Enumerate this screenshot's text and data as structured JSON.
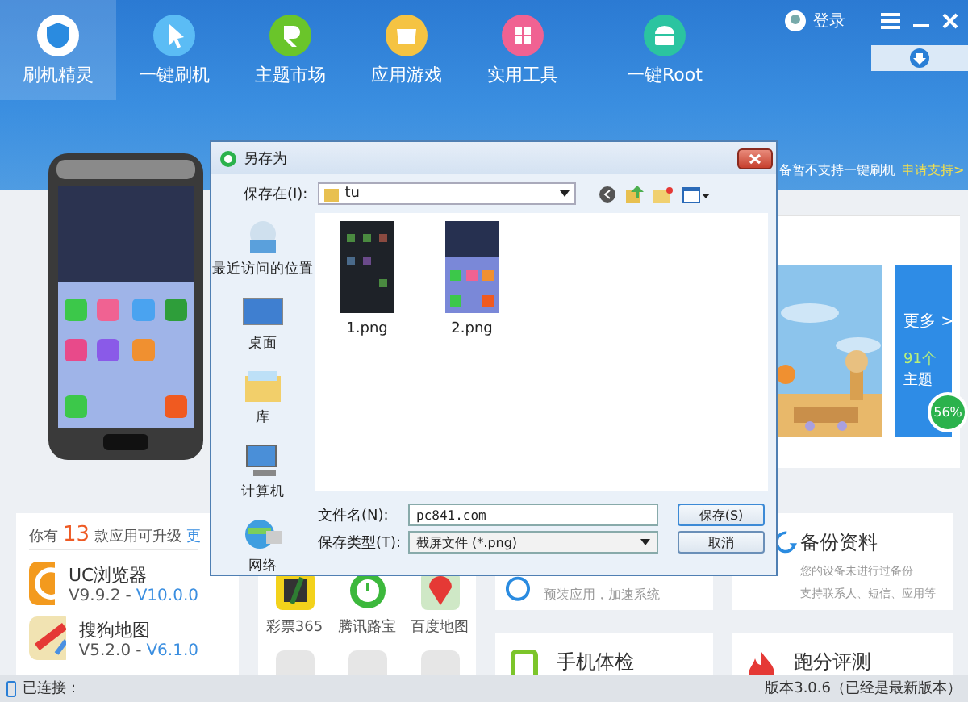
{
  "header": {
    "nav_items": [
      {
        "label": "刷机精灵",
        "kind": "shield",
        "selected": true
      },
      {
        "label": "一键刷机",
        "kind": "cursor",
        "selected": false
      },
      {
        "label": "主题市场",
        "kind": "ring",
        "selected": false
      },
      {
        "label": "应用游戏",
        "kind": "bag",
        "selected": false
      },
      {
        "label": "实用工具",
        "kind": "grid",
        "selected": false
      },
      {
        "label": "一键Root",
        "kind": "android",
        "selected": false
      }
    ],
    "login": "登录",
    "notice": "备暂不支持一键刷机",
    "notice_link": "申请支持>"
  },
  "themes": {
    "more": "更多 >",
    "count": "91个",
    "count_label": "主题",
    "progress": "56%"
  },
  "updates": {
    "prefix": "你有",
    "count": "13",
    "suffix": "款应用可升级",
    "more": "更",
    "apps": [
      {
        "name": "UC浏览器",
        "current": "V9.9.2",
        "separator": "-",
        "latest": "V10.0.0",
        "kind": "squirrel"
      },
      {
        "name": "搜狗地图",
        "current": "V5.2.0",
        "separator": "-",
        "latest": "V6.1.0",
        "kind": "map"
      }
    ]
  },
  "apps": [
    {
      "name": "彩票365",
      "kind": "lottery"
    },
    {
      "name": "腾讯路宝",
      "kind": "clock"
    },
    {
      "name": "百度地图",
      "kind": "pin"
    }
  ],
  "tools": [
    {
      "description": [
        "预装应用，加速系统"
      ],
      "kind": "speed"
    },
    {
      "title": "备份资料",
      "description": [
        "您的设备未进行过备份",
        "支持联系人、短信、应用等"
      ],
      "kind": "backup"
    },
    {
      "title": "手机体检",
      "kind": "checkup"
    },
    {
      "title": "跑分评测",
      "kind": "benchmark"
    }
  ],
  "dialog": {
    "title": "另存为",
    "save_in_label": "保存在(I):",
    "folder": "tu",
    "places": [
      {
        "label": "最近访问的位置",
        "kind": "recent"
      },
      {
        "label": "桌面",
        "kind": "desktop"
      },
      {
        "label": "库",
        "kind": "library"
      },
      {
        "label": "计算机",
        "kind": "computer"
      },
      {
        "label": "网络",
        "kind": "network"
      }
    ],
    "files": [
      {
        "name": "1.png",
        "kind": "dark"
      },
      {
        "name": "2.png",
        "kind": "light"
      }
    ],
    "file_name_label": "文件名(N):",
    "file_name": "pc841.com",
    "file_type_label": "保存类型(T):",
    "file_type": "截屏文件 (*.png)",
    "save_button": "保存(S)",
    "cancel_button": "取消"
  },
  "status_bar": {
    "connection": "已连接：",
    "version": "版本3.0.6（已经是最新版本）"
  }
}
